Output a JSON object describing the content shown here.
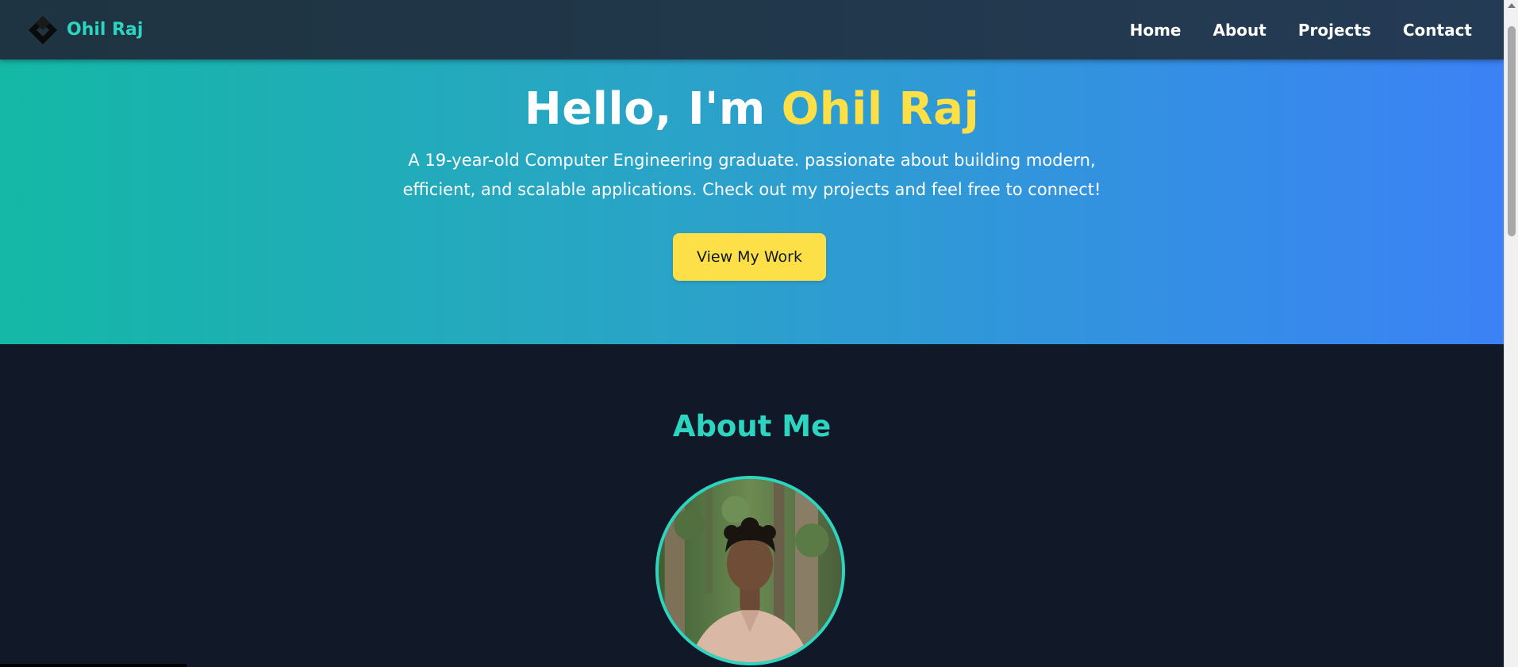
{
  "nav": {
    "brand_name": "Ohil Raj",
    "links": [
      "Home",
      "About",
      "Projects",
      "Contact"
    ]
  },
  "hero": {
    "greeting": "Hello, I'm ",
    "name": "Ohil Raj",
    "description": "A 19-year-old Computer Engineering graduate. passionate about building modern, efficient, and scalable applications. Check out my projects and feel free to connect!",
    "cta_label": "View My Work"
  },
  "about": {
    "title": "About Me"
  },
  "icons": {
    "brand_logo": "diamond-logo-icon",
    "scroll_up": "chevron-up-icon"
  },
  "colors": {
    "accent_teal": "#2dd4bf",
    "highlight_yellow": "#fde047",
    "hero_gradient_start": "#14b8a6",
    "hero_gradient_end": "#3b82f6",
    "dark_bg": "#111827",
    "nav_bg": "#1e3441"
  }
}
